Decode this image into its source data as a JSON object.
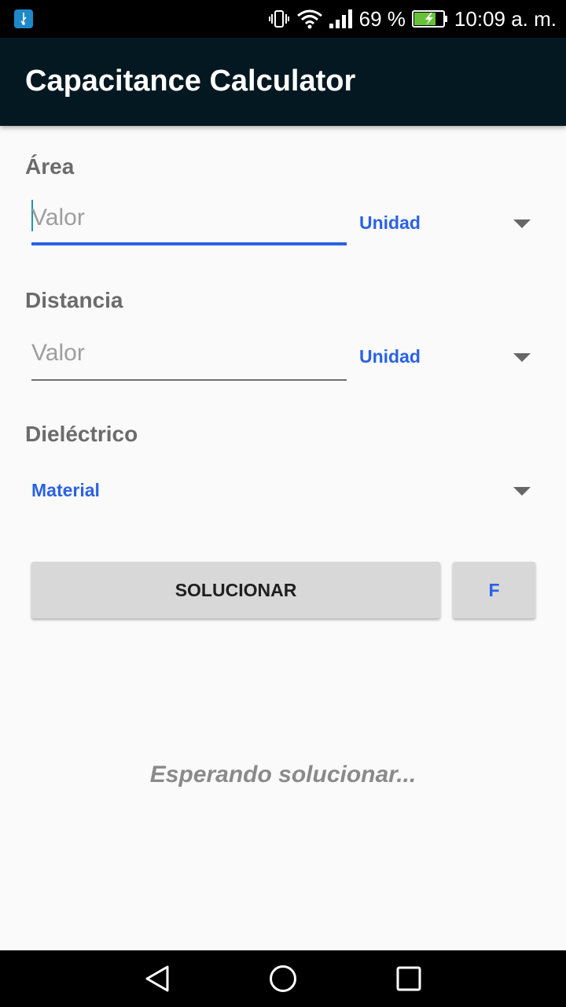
{
  "status_bar": {
    "battery_percent": "69 %",
    "time": "10:09 a. m.",
    "icons": [
      "usb-icon",
      "vibrate-icon",
      "wifi-icon",
      "signal-icon",
      "battery-charging-icon"
    ]
  },
  "app_bar": {
    "title": "Capacitance Calculator",
    "color": "#031821"
  },
  "form": {
    "area": {
      "label": "Área",
      "value_placeholder": "Valor",
      "unit_label": "Unidad"
    },
    "distance": {
      "label": "Distancia",
      "value_placeholder": "Valor",
      "unit_label": "Unidad"
    },
    "dielectric": {
      "label": "Dieléctrico",
      "material_label": "Material"
    }
  },
  "actions": {
    "solve_label": "SOLUCIONAR",
    "unit_label": "F"
  },
  "result": {
    "text": "Esperando solucionar..."
  },
  "colors": {
    "accent": "#2b62e3",
    "button_bg": "#d8d8d8",
    "label_gray": "#6b6b6b"
  }
}
